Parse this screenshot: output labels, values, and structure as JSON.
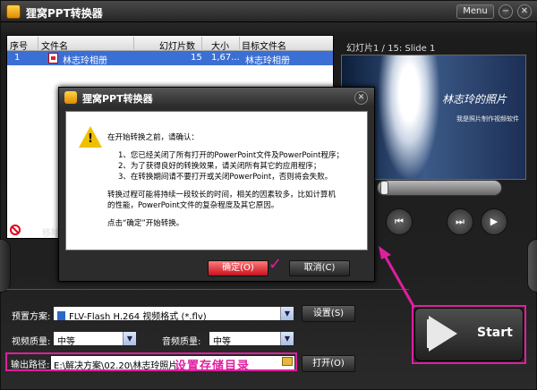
{
  "app": {
    "title": "狸窝PPT转换器",
    "menu_label": "Menu",
    "minimize": "−",
    "close": "✕"
  },
  "file_list": {
    "columns": [
      "序号",
      "文件名",
      "幻灯片数",
      "大小",
      "目标文件名"
    ],
    "rows": [
      {
        "index": "1",
        "name": "林志玲相册",
        "slides": "15",
        "size": "1,67...",
        "target": "林志玲相册"
      }
    ],
    "remove_label": "移除"
  },
  "preview": {
    "title": "幻灯片1 / 15: Slide 1",
    "slide_text": "林志玲的照片",
    "slide_sub": "我是照片制作视频软件",
    "prev": "⏮",
    "next": "⏭",
    "play": "▶"
  },
  "settings": {
    "preset_label": "预置方案:",
    "preset_value": "FLV-Flash H.264 视频格式 (*.flv)",
    "settings_button": "设置(S)",
    "video_quality_label": "视频质量:",
    "video_quality_value": "中等",
    "audio_quality_label": "音频质量:",
    "audio_quality_value": "中等",
    "output_label": "输出路径:",
    "output_value": "E:\\解决方案\\02.20\\林志玲照片",
    "open_button": "打开(O)",
    "annotation": "设置存储目录"
  },
  "start_button": "Start",
  "dialog": {
    "title": "狸窝PPT转换器",
    "close": "✕",
    "lines": [
      "在开始转换之前，请确认：",
      "1、您已经关闭了所有打开的PowerPoint文件及PowerPoint程序；",
      "2、为了获得良好的转换效果，请关闭所有其它的应用程序；",
      "3、在转换期间请不要打开或关闭PowerPoint，否则将会失败。",
      "转换过程可能将持续一段较长的时间，相关的因素较多，比如计算机",
      "的性能，PowerPoint文件的复杂程度及其它原因。",
      "点击“确定”开始转换。"
    ],
    "ok_button": "确定(O)",
    "cancel_button": "取消(C)"
  },
  "colors": {
    "annotation": "#e01ea0",
    "selection": "#3b6fd4",
    "ok": "#c8101e"
  }
}
